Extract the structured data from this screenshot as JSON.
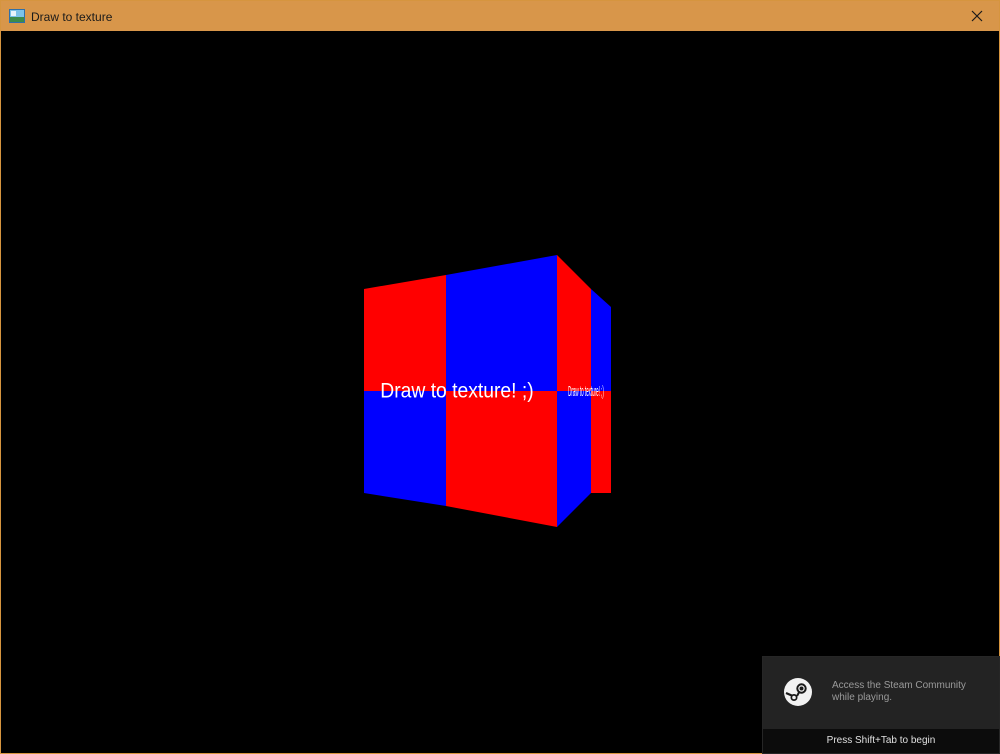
{
  "window": {
    "title": "Draw to texture",
    "titlebar_color": "#d8964a",
    "close_icon": "close-icon"
  },
  "scene": {
    "background": "#000000",
    "cube_colors": {
      "red": "#ff0000",
      "blue": "#0000ff"
    },
    "front_face_text": "Draw to texture!  ;)",
    "side_face_text": "Draw to texture!  ;)"
  },
  "steam_overlay": {
    "icon": "steam-logo-icon",
    "message_line1": "Access the Steam Community",
    "message_line2": "while playing.",
    "hint": "Press Shift+Tab to begin"
  }
}
